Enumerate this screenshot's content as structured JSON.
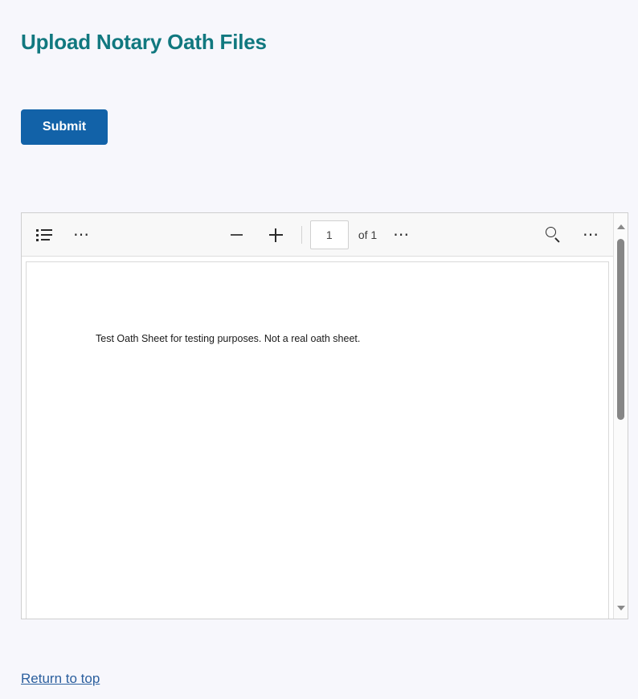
{
  "header": {
    "title": "Upload Notary Oath Files",
    "title_color": "#11787f"
  },
  "form": {
    "submit_label": "Submit",
    "submit_color": "#1262a8"
  },
  "pdf_viewer": {
    "toolbar": {
      "outline_icon": "list-outline-icon",
      "left_more_icon": "ellipsis-icon",
      "zoom_out_icon": "minus-icon",
      "zoom_in_icon": "plus-icon",
      "page_number_value": "1",
      "page_total_label": "of 1",
      "center_more_icon": "ellipsis-icon",
      "search_icon": "search-icon",
      "right_more_icon": "ellipsis-icon"
    },
    "document": {
      "body_text": "Test Oath Sheet for testing purposes. Not a real oath sheet."
    },
    "scrollbar": {
      "up_arrow_icon": "triangle-up-icon",
      "down_arrow_icon": "triangle-down-icon"
    }
  },
  "footer": {
    "return_link_label": "Return to top",
    "link_color": "#2b5f9e"
  }
}
